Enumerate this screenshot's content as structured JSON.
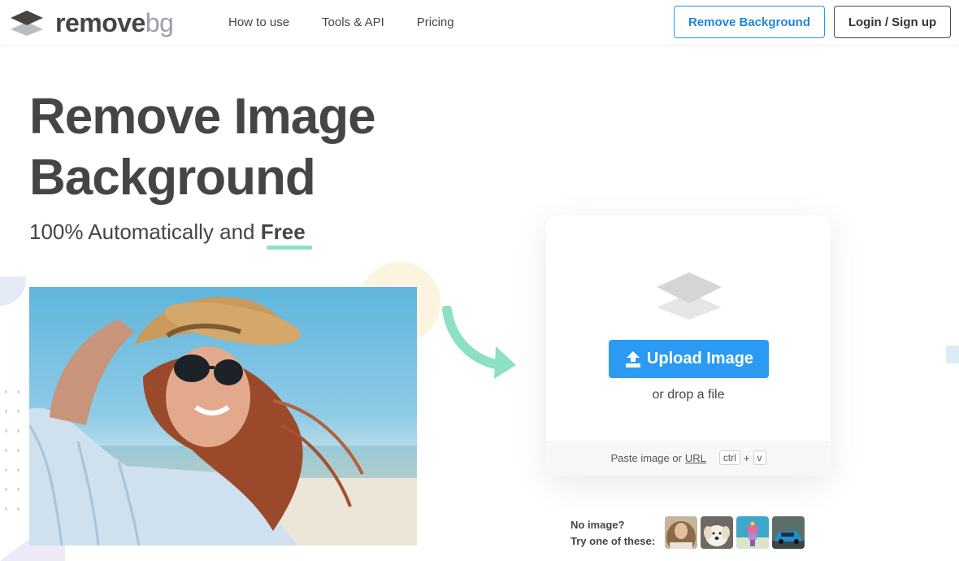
{
  "header": {
    "logo_remove": "remove",
    "logo_bg": "bg",
    "nav": [
      "How to use",
      "Tools & API",
      "Pricing"
    ],
    "cta_label": "Remove Background",
    "login_label": "Login / Sign up"
  },
  "hero": {
    "title_line1": "Remove Image",
    "title_line2": "Background",
    "subtitle_prefix": "100% Automatically and ",
    "subtitle_free": "Free"
  },
  "upload": {
    "button_label": "Upload Image",
    "drop_text": "or drop a file",
    "paste_prefix": "Paste image or",
    "paste_url": "URL",
    "key_ctrl": "ctrl",
    "key_plus": "+",
    "key_v": "v"
  },
  "samples": {
    "line1": "No image?",
    "line2": "Try one of these:",
    "items": [
      "woman-portrait",
      "dog",
      "cake-figurine",
      "blue-car"
    ]
  },
  "colors": {
    "accent": "#2b9af3",
    "text": "#454545",
    "highlight": "#8ee0c2"
  }
}
